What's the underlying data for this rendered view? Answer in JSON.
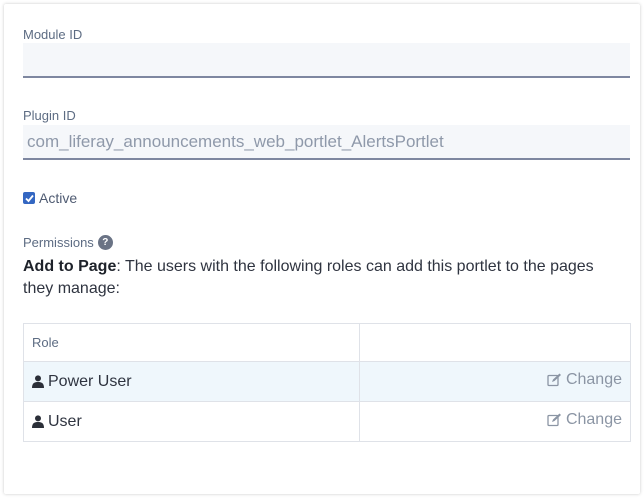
{
  "form": {
    "module_id": {
      "label": "Module ID",
      "value": ""
    },
    "plugin_id": {
      "label": "Plugin ID",
      "value": "com_liferay_announcements_web_portlet_AlertsPortlet"
    },
    "active": {
      "label": "Active",
      "checked": true
    }
  },
  "permissions": {
    "heading": "Permissions",
    "help_icon": "question-circle-icon",
    "description_bold": "Add to Page",
    "description_rest": ": The users with the following roles can add this portlet to the pages they manage:",
    "table": {
      "headers": [
        "Role",
        ""
      ],
      "rows": [
        {
          "role": "Power User",
          "action": "Change",
          "highlighted": true
        },
        {
          "role": "User",
          "action": "Change",
          "highlighted": false
        }
      ]
    }
  },
  "icons": {
    "user": "user-icon",
    "change": "edit-icon"
  },
  "colors": {
    "accent": "#3467c2",
    "row_highlight": "#eff7fc",
    "input_bg": "#f5f7fa"
  }
}
